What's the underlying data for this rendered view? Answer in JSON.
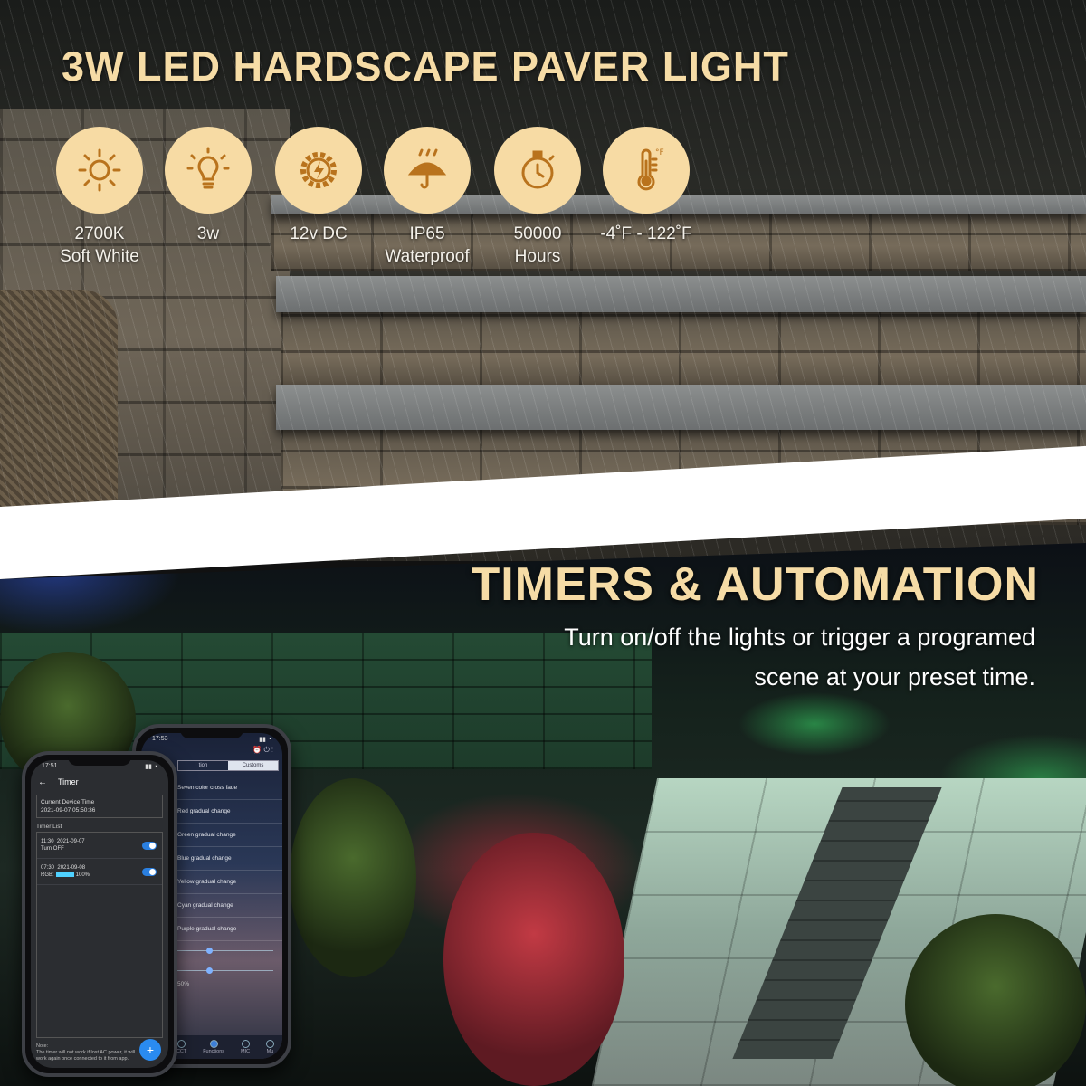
{
  "top": {
    "title": "3W LED HARDSCAPE PAVER LIGHT",
    "features": [
      {
        "icon": "sun-icon",
        "label": "2700K\nSoft White"
      },
      {
        "icon": "bulb-icon",
        "label": "3w"
      },
      {
        "icon": "power-gear-icon",
        "label": "12v DC"
      },
      {
        "icon": "umbrella-rain-icon",
        "label": "IP65\nWaterproof"
      },
      {
        "icon": "stopwatch-icon",
        "label": "50000\nHours"
      },
      {
        "icon": "thermometer-icon",
        "label": "-4˚F - 122˚F"
      }
    ],
    "accent_color": "#f7dba4"
  },
  "bottom": {
    "title": "TIMERS & AUTOMATION",
    "subtitle_line1": "Turn on/off the lights or trigger a programed",
    "subtitle_line2": "scene at your preset time."
  },
  "phone_back": {
    "time": "17:53",
    "tabs": [
      "tion",
      "Customs"
    ],
    "scenes": [
      "Seven color cross fade",
      "Red gradual change",
      "Green gradual change",
      "Blue gradual change",
      "Yellow gradual change",
      "Cyan gradual change",
      "Purple gradual change"
    ],
    "percent": "50%",
    "nav": [
      "CCT",
      "Functions",
      "MIC",
      "Mu"
    ]
  },
  "phone_front": {
    "time": "17:51",
    "header": "Timer",
    "current_time_label": "Current Device Time",
    "current_time_value": "2021-09-07 05:50:36",
    "timer_list_label": "Timer List",
    "timers": [
      {
        "time": "11:30",
        "date": "2021-09-07",
        "action": "Turn OFF"
      },
      {
        "time": "07:30",
        "date": "2021-09-08",
        "action_prefix": "RGB:",
        "action_suffix": "100%"
      }
    ],
    "note": "Note:\nThe timer will not work if lost AC power, it will work again once connected to it from app.",
    "fab_label": "+"
  }
}
